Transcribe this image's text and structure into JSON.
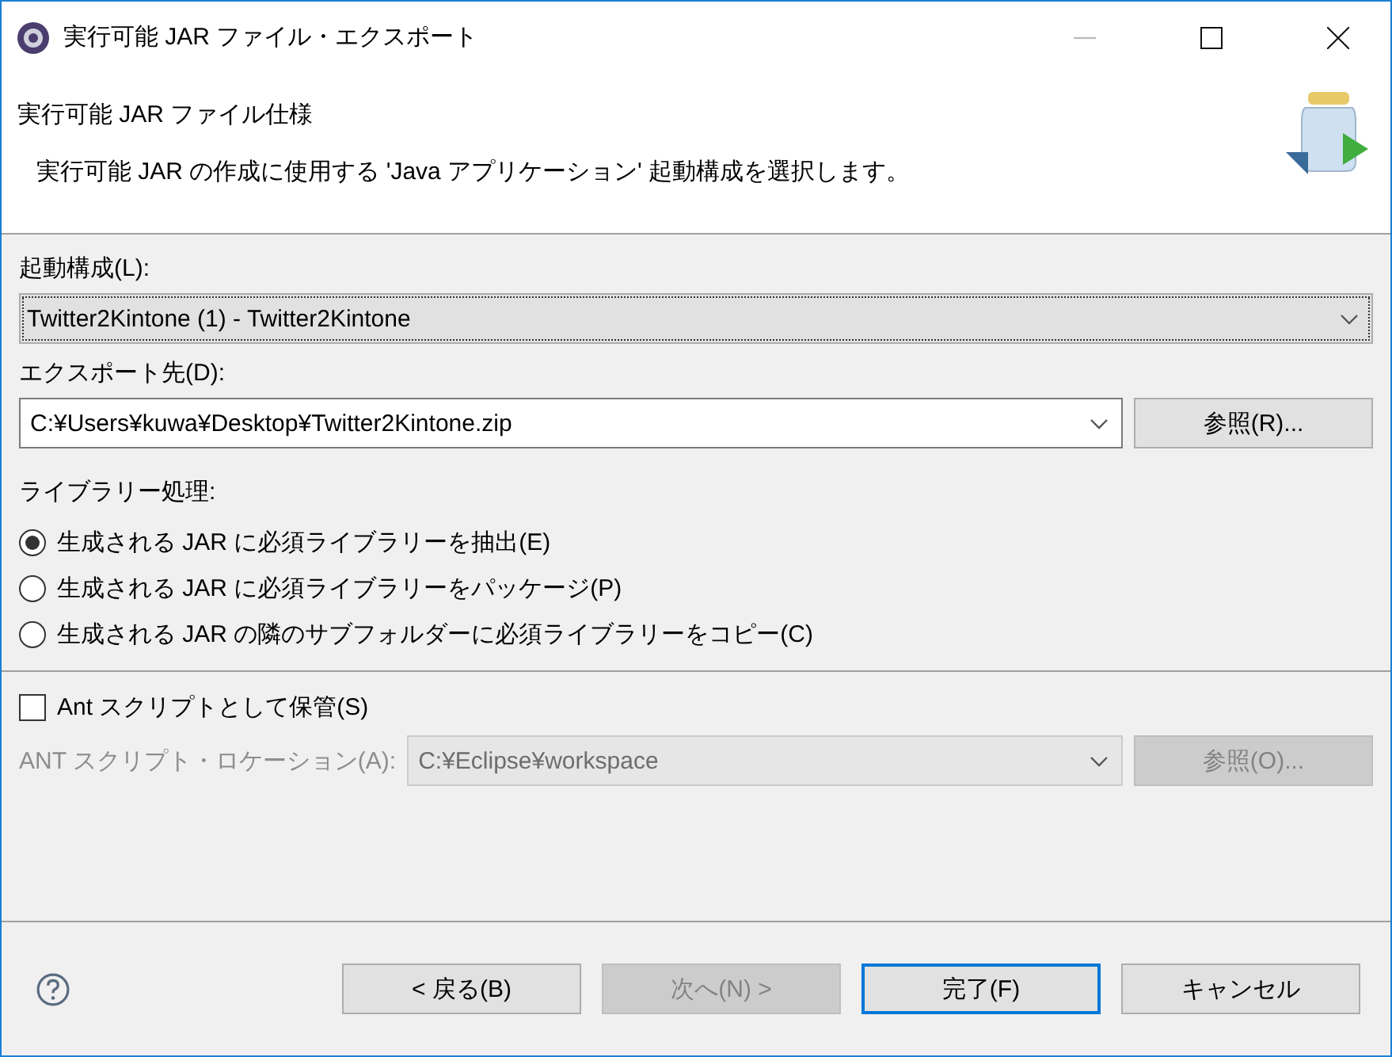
{
  "window": {
    "title": "実行可能 JAR ファイル・エクスポート"
  },
  "header": {
    "title": "実行可能 JAR ファイル仕様",
    "description": "実行可能 JAR の作成に使用する 'Java アプリケーション' 起動構成を選択します。"
  },
  "launch_config": {
    "label": "起動構成(L):",
    "value": "Twitter2Kintone (1) - Twitter2Kintone"
  },
  "export_destination": {
    "label": "エクスポート先(D):",
    "value": "C:¥Users¥kuwa¥Desktop¥Twitter2Kintone.zip",
    "browse_button": "参照(R)..."
  },
  "library_handling": {
    "label": "ライブラリー処理:",
    "options": [
      {
        "label": "生成される JAR に必須ライブラリーを抽出(E)",
        "selected": true
      },
      {
        "label": "生成される JAR に必須ライブラリーをパッケージ(P)",
        "selected": false
      },
      {
        "label": "生成される JAR の隣のサブフォルダーに必須ライブラリーをコピー(C)",
        "selected": false
      }
    ]
  },
  "ant_script": {
    "save": {
      "label": "Ant スクリプトとして保管(S)",
      "checked": false
    },
    "location": {
      "label": "ANT スクリプト・ロケーション(A):",
      "value": "C:¥Eclipse¥workspace",
      "disabled": true,
      "browse_button": "参照(O)..."
    }
  },
  "buttons": [
    {
      "label": "< 戻る(B)",
      "disabled": false,
      "default": false
    },
    {
      "label": "次へ(N) >",
      "disabled": true,
      "default": false
    },
    {
      "label": "完了(F)",
      "disabled": false,
      "default": true
    },
    {
      "label": "キャンセル",
      "disabled": false,
      "default": false
    }
  ]
}
